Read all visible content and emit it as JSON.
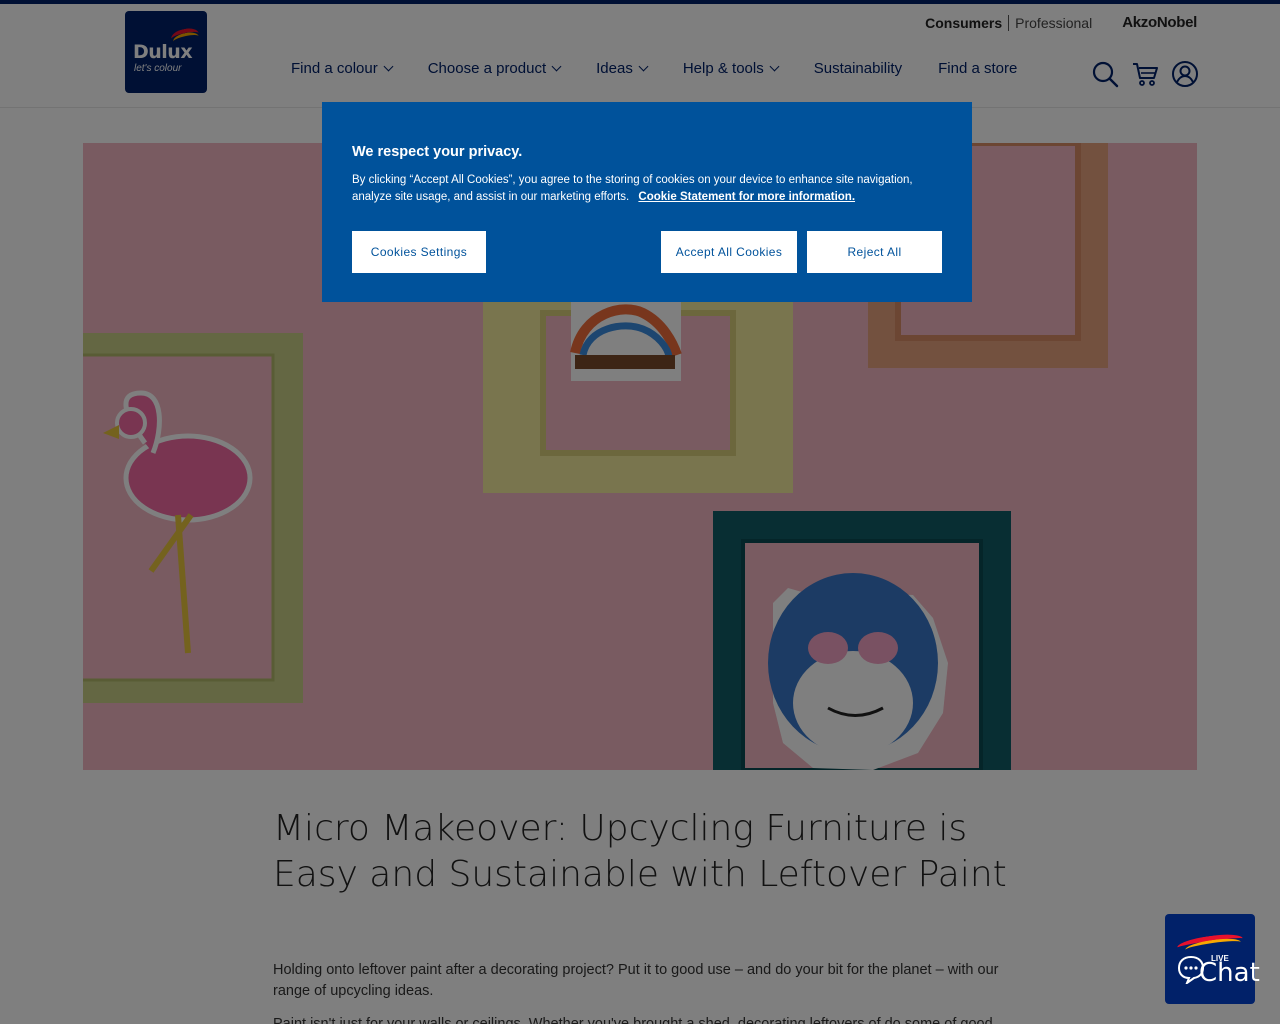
{
  "header": {
    "logo": {
      "brand": "Dulux",
      "tagline": "let's colour"
    },
    "utility": {
      "consumers": "Consumers",
      "professional": "Professional",
      "akzonobel": "AkzoNobel"
    },
    "nav": [
      {
        "label": "Find a colour",
        "has_dropdown": true
      },
      {
        "label": "Choose a product",
        "has_dropdown": true
      },
      {
        "label": "Ideas",
        "has_dropdown": true
      },
      {
        "label": "Help & tools",
        "has_dropdown": true
      },
      {
        "label": "Sustainability",
        "has_dropdown": false
      },
      {
        "label": "Find a store",
        "has_dropdown": false
      }
    ],
    "icons": [
      "search-icon",
      "cart-icon",
      "account-icon"
    ]
  },
  "article": {
    "headline": "Micro Makeover: Upcycling Furniture is Easy and Sustainable with Leftover Paint",
    "intro": "Holding onto leftover paint after a decorating project? Put it to good use – and do your bit for the planet – with our range of upcycling ideas.",
    "intro2": "Paint isn't just for your walls or ceilings. Whether you've brought a shed, decorating leftovers of do some of good use"
  },
  "cookie_banner": {
    "title": "We respect your privacy.",
    "text": "By clicking “Accept All Cookies”, you agree to the storing of cookies on your device to enhance site navigation, analyze site usage, and assist in our marketing efforts.",
    "link": "Cookie Statement for more information.",
    "settings_button": "Cookies Settings",
    "accept_button": "Accept All Cookies",
    "reject_button": "Reject All"
  },
  "chat": {
    "live": "LIVE",
    "word": "Chat"
  },
  "colors": {
    "brand_navy": "#012169",
    "cookie_blue": "#00529b",
    "wall_pink": "#f3b8c3"
  }
}
